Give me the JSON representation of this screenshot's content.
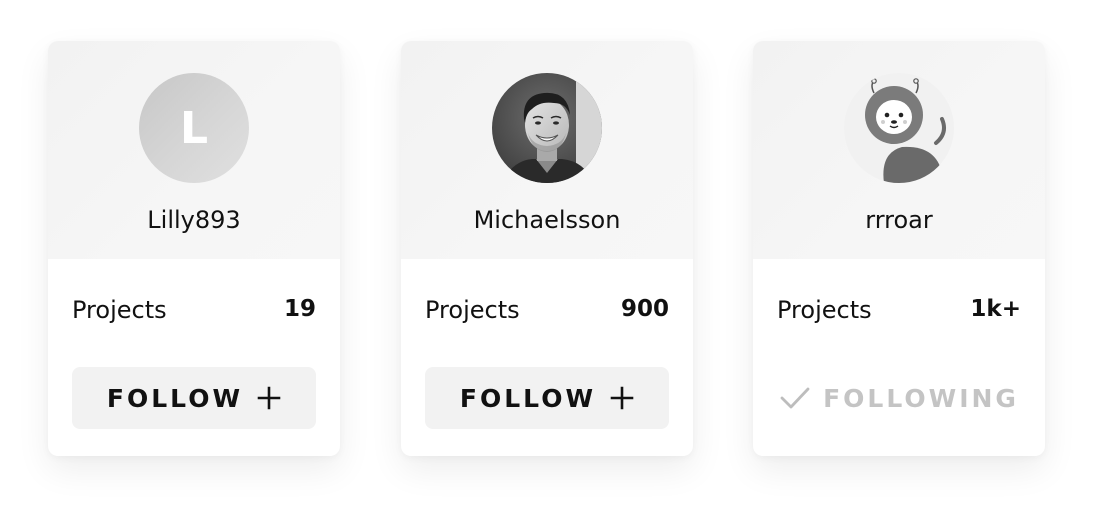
{
  "cards": [
    {
      "username": "Lilly893",
      "avatar": {
        "kind": "initial",
        "letter": "L"
      },
      "stat_label": "Projects",
      "stat_value": "19",
      "button": {
        "label": "FOLLOW",
        "icon": "plus-icon",
        "state": "not-following"
      }
    },
    {
      "username": "Michaelsson",
      "avatar": {
        "kind": "photo",
        "icon": "profile-photo"
      },
      "stat_label": "Projects",
      "stat_value": "900",
      "button": {
        "label": "FOLLOW",
        "icon": "plus-icon",
        "state": "not-following"
      }
    },
    {
      "username": "rrroar",
      "avatar": {
        "kind": "illustration",
        "icon": "lion-mascot"
      },
      "stat_label": "Projects",
      "stat_value": "1k+",
      "button": {
        "label": "FOLLOWING",
        "icon": "check-icon",
        "state": "following"
      }
    }
  ],
  "colors": {
    "card_top": "#f4f4f4",
    "card_bottom": "#ffffff",
    "button_bg": "#f2f2f2",
    "text_primary": "#111111",
    "text_muted": "#c4c4c4",
    "avatar_initial_bg": "#d0d0d0"
  }
}
